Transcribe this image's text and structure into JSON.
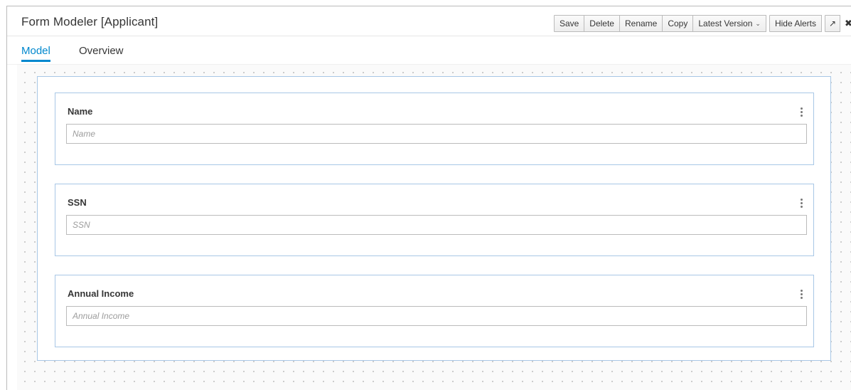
{
  "header": {
    "title": "Form Modeler [Applicant]"
  },
  "toolbar": {
    "save_label": "Save",
    "delete_label": "Delete",
    "rename_label": "Rename",
    "copy_label": "Copy",
    "version_label": "Latest Version",
    "hide_alerts_label": "Hide Alerts",
    "maximize_icon": "↗",
    "close_icon": "✖"
  },
  "tabs": [
    {
      "label": "Model",
      "active": true
    },
    {
      "label": "Overview",
      "active": false
    }
  ],
  "fields": [
    {
      "label": "Name",
      "placeholder": "Name"
    },
    {
      "label": "SSN",
      "placeholder": "SSN"
    },
    {
      "label": "Annual Income",
      "placeholder": "Annual Income"
    }
  ],
  "colors": {
    "accent": "#0088ce",
    "field_border": "#a8c7e6"
  }
}
